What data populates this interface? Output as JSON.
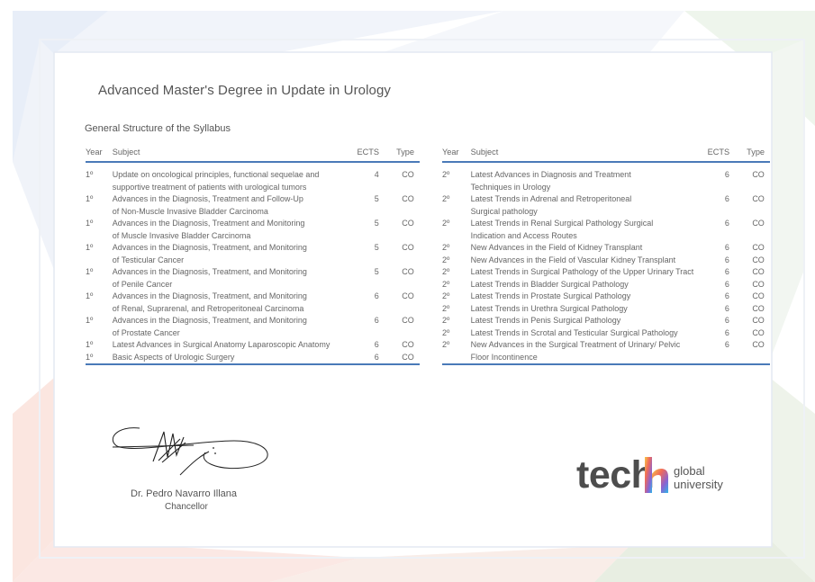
{
  "document": {
    "title": "Advanced Master's Degree in Update in Urology",
    "subtitle": "General Structure of the Syllabus"
  },
  "columns": {
    "year": "Year",
    "subject": "Subject",
    "ects": "ECTS",
    "type": "Type"
  },
  "left_rows": [
    {
      "year": "1º",
      "subject": [
        "Update on oncological principles, functional sequelae and",
        "supportive treatment of patients with urological tumors"
      ],
      "ects": "4",
      "type": "CO"
    },
    {
      "year": "1º",
      "subject": [
        "Advances in the Diagnosis, Treatment and Follow-Up",
        "of Non-Muscle Invasive Bladder Carcinoma"
      ],
      "ects": "5",
      "type": "CO"
    },
    {
      "year": "1º",
      "subject": [
        "Advances in the Diagnosis, Treatment and Monitoring",
        "of Muscle Invasive Bladder Carcinoma"
      ],
      "ects": "5",
      "type": "CO"
    },
    {
      "year": "1º",
      "subject": [
        "Advances in the Diagnosis, Treatment, and Monitoring",
        "of Testicular Cancer"
      ],
      "ects": "5",
      "type": "CO"
    },
    {
      "year": "1º",
      "subject": [
        "Advances in the Diagnosis, Treatment, and Monitoring",
        "of Penile Cancer"
      ],
      "ects": "5",
      "type": "CO"
    },
    {
      "year": "1º",
      "subject": [
        "Advances in the Diagnosis, Treatment, and Monitoring",
        "of Renal, Suprarenal, and Retroperitoneal Carcinoma"
      ],
      "ects": "6",
      "type": "CO"
    },
    {
      "year": "1º",
      "subject": [
        "Advances in the Diagnosis, Treatment, and Monitoring",
        "of Prostate Cancer"
      ],
      "ects": "6",
      "type": "CO"
    },
    {
      "year": "1º",
      "subject": [
        "Latest Advances in Surgical Anatomy Laparoscopic Anatomy"
      ],
      "ects": "6",
      "type": "CO"
    },
    {
      "year": "1º",
      "subject": [
        "Basic Aspects of Urologic Surgery"
      ],
      "ects": "6",
      "type": "CO"
    }
  ],
  "right_rows": [
    {
      "year": "2º",
      "subject": [
        "Latest Advances in Diagnosis and Treatment",
        "Techniques in Urology"
      ],
      "ects": "6",
      "type": "CO"
    },
    {
      "year": "2º",
      "subject": [
        "Latest Trends in Adrenal and Retroperitoneal",
        "Surgical pathology"
      ],
      "ects": "6",
      "type": "CO"
    },
    {
      "year": "2º",
      "subject": [
        "Latest Trends in Renal Surgical Pathology Surgical",
        "Indication and Access Routes"
      ],
      "ects": "6",
      "type": "CO"
    },
    {
      "year": "2º",
      "subject": [
        "New Advances in the Field of Kidney Transplant"
      ],
      "ects": "6",
      "type": "CO"
    },
    {
      "year": "2º",
      "subject": [
        "New Advances in the Field of Vascular Kidney Transplant"
      ],
      "ects": "6",
      "type": "CO"
    },
    {
      "year": "2º",
      "subject": [
        "Latest Trends in Surgical Pathology of the Upper Urinary Tract"
      ],
      "ects": "6",
      "type": "CO"
    },
    {
      "year": "2º",
      "subject": [
        "Latest Trends in Bladder Surgical Pathology"
      ],
      "ects": "6",
      "type": "CO"
    },
    {
      "year": "2º",
      "subject": [
        "Latest Trends in Prostate Surgical Pathology"
      ],
      "ects": "6",
      "type": "CO"
    },
    {
      "year": "2º",
      "subject": [
        "Latest Trends in Urethra Surgical Pathology"
      ],
      "ects": "6",
      "type": "CO"
    },
    {
      "year": "2º",
      "subject": [
        "Latest Trends in Penis Surgical Pathology"
      ],
      "ects": "6",
      "type": "CO"
    },
    {
      "year": "2º",
      "subject": [
        "Latest Trends in Scrotal and Testicular Surgical Pathology"
      ],
      "ects": "6",
      "type": "CO"
    },
    {
      "year": "2º",
      "subject": [
        "New Advances in the Surgical Treatment of Urinary/ Pelvic",
        "Floor Incontinence"
      ],
      "ects": "6",
      "type": "CO"
    }
  ],
  "signer": {
    "name": "Dr. Pedro Navarro Illana",
    "role": "Chancellor"
  },
  "logo": {
    "brand": "tech",
    "line1": "global",
    "line2": "university",
    "icon": "tech-logo-icon"
  },
  "colors": {
    "rule": "#4a7ab8",
    "text": "#555555"
  }
}
